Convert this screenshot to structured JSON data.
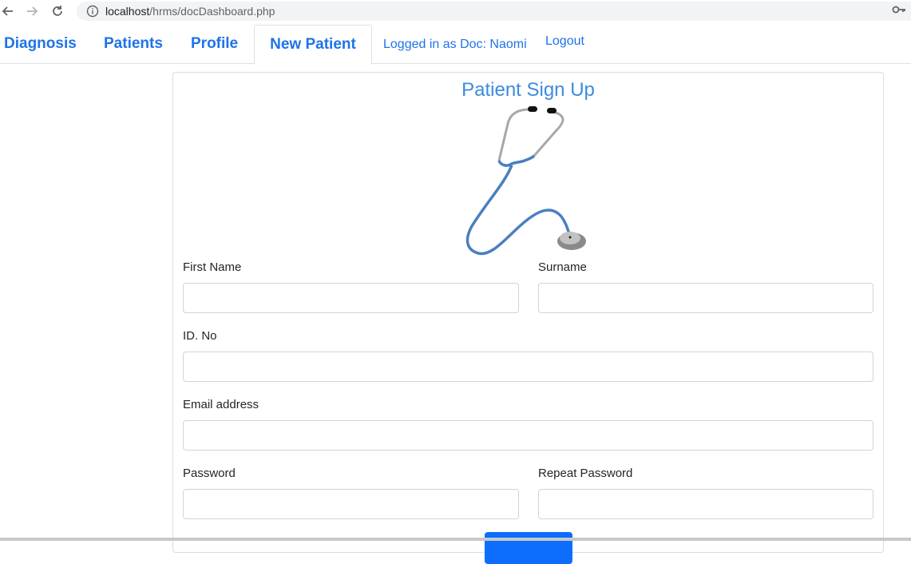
{
  "browser": {
    "url_host": "localhost",
    "url_path": "/hrms/docDashboard.php"
  },
  "nav": {
    "tabs": [
      {
        "label": "Diagnosis"
      },
      {
        "label": "Patients"
      },
      {
        "label": "Profile"
      },
      {
        "label": "New Patient",
        "active": true
      }
    ],
    "logged_in": "Logged in as Doc: Naomi",
    "logout": "Logout"
  },
  "form": {
    "title": "Patient Sign Up",
    "first_name": {
      "label": "First Name",
      "value": ""
    },
    "surname": {
      "label": "Surname",
      "value": ""
    },
    "id_no": {
      "label": "ID. No",
      "value": ""
    },
    "email": {
      "label": "Email address",
      "value": ""
    },
    "password": {
      "label": "Password",
      "value": ""
    },
    "repeat_password": {
      "label": "Repeat Password",
      "value": ""
    },
    "submit": ""
  },
  "colors": {
    "link": "#1e73e8",
    "title": "#3b8be0",
    "primary": "#0d6efd"
  }
}
